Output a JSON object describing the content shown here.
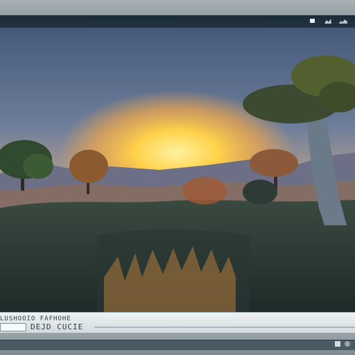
{
  "window": {
    "titlebar_icons": [
      "minimize-icon",
      "restore-icon",
      "settings-icon"
    ]
  },
  "status": {
    "line1": "LUSHOOIO FAFHOHE",
    "line2": "DEJD CUCIE"
  },
  "bottom": {
    "icons": [
      "screen-icon",
      "camera-icon"
    ]
  },
  "colors": {
    "titlebar": "#1b2b36",
    "sky_top": "#4c5f7f",
    "sun": "#ffd24a",
    "status_bg": "#e6ecef"
  }
}
